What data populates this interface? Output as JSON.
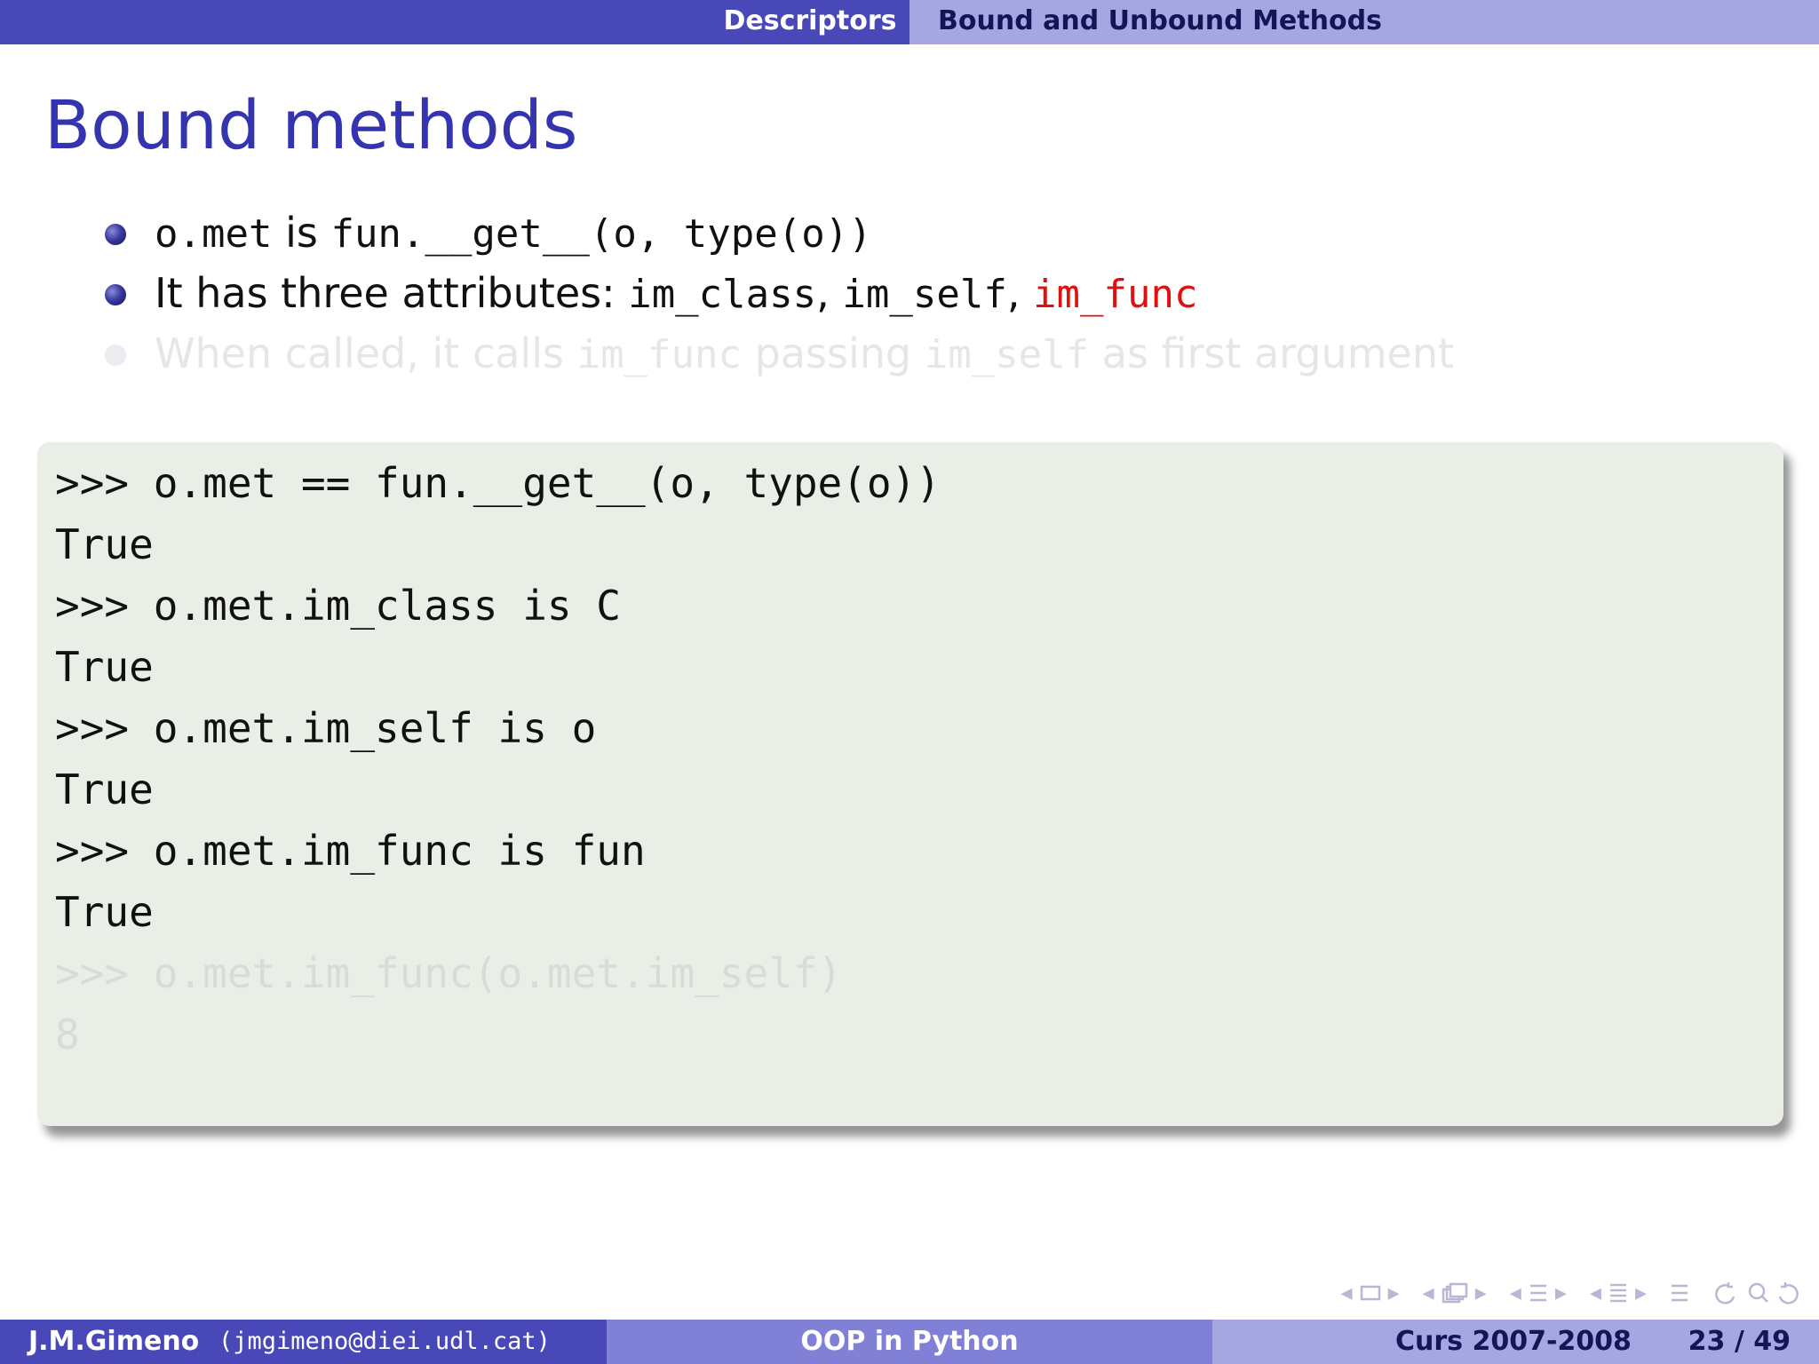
{
  "header": {
    "section": "Descriptors",
    "subsection": "Bound and Unbound Methods"
  },
  "slide": {
    "title": "Bound methods",
    "bullets": [
      {
        "parts": [
          "o.met",
          " is ",
          "fun.__get__(o, type(o))"
        ]
      },
      {
        "parts": [
          "It has three attributes: ",
          "im_class",
          ", ",
          "im_self",
          ", ",
          "im_func"
        ]
      },
      {
        "parts": [
          "When called, it calls ",
          "im_func",
          " passing ",
          "im_self",
          " as first argument"
        ]
      }
    ]
  },
  "code": {
    "lines": [
      ">>> o.met == fun.__get__(o, type(o))",
      "True",
      ">>> o.met.im_class is C",
      "True",
      ">>> o.met.im_self is o",
      "True",
      ">>> o.met.im_func is fun",
      "True",
      ">>> o.met.im_func(o.met.im_self)",
      "8"
    ]
  },
  "footer": {
    "author": "J.M.Gimeno",
    "email": "(jmgimeno@diei.udl.cat)",
    "title": "OOP in Python",
    "course": "Curs 2007-2008",
    "page": "23 / 49"
  },
  "colors": {
    "theme_dark": "#4848b8",
    "theme_mid": "#8080d6",
    "theme_light": "#a6a6e2",
    "title": "#3434b0",
    "highlight": "#e01010",
    "code_bg": "#e9efe6"
  },
  "nav_icons": [
    "slide-nav-icon",
    "frame-nav-icon",
    "subsection-nav-icon",
    "section-nav-icon",
    "outline-icon",
    "search-icon"
  ]
}
